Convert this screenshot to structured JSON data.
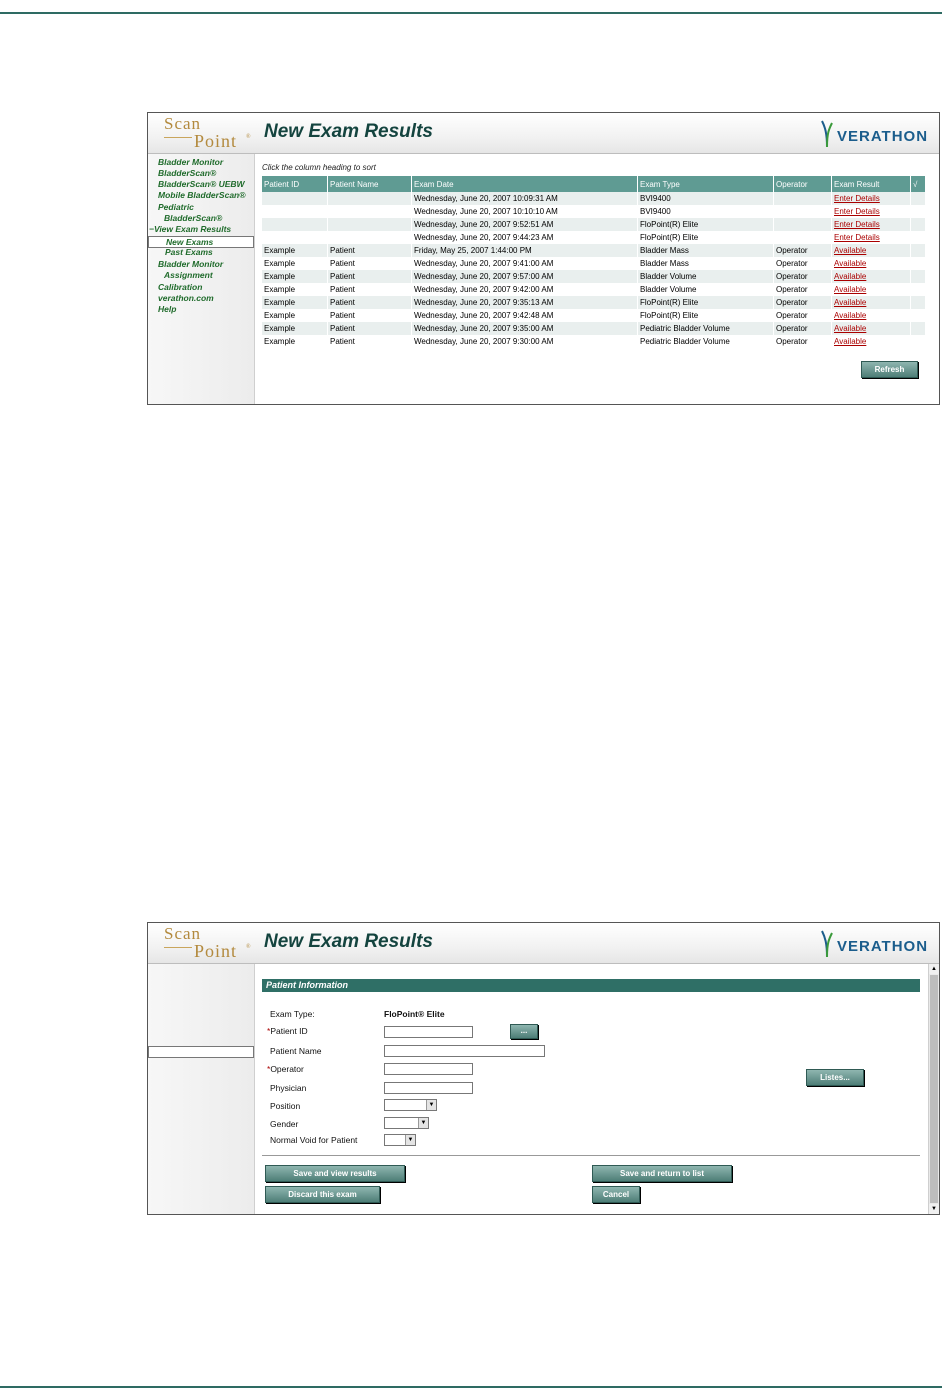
{
  "panel1": {
    "logo": {
      "line1": "Scan",
      "line2": "Point",
      "reg": "®"
    },
    "title": "New Exam Results",
    "brand": "VERATHON",
    "sidebar": [
      {
        "label": "Bladder Monitor",
        "indent": 0
      },
      {
        "label": "BladderScan®",
        "indent": 0
      },
      {
        "label": "BladderScan® UEBW",
        "indent": 0
      },
      {
        "label": "Mobile BladderScan®",
        "indent": 0
      },
      {
        "label": "Pediatric",
        "indent": 0
      },
      {
        "label": "BladderScan®",
        "indent": 1
      },
      {
        "label": "−View Exam Results",
        "indent": -1
      },
      {
        "label": "New Exams",
        "indent": 2,
        "selected": true
      },
      {
        "label": "Past Exams",
        "indent": 2
      },
      {
        "label": "Bladder Monitor",
        "indent": 0
      },
      {
        "label": "Assignment",
        "indent": 1
      },
      {
        "label": "Calibration",
        "indent": 0
      },
      {
        "label": "verathon.com",
        "indent": 0
      },
      {
        "label": "Help",
        "indent": 0
      }
    ],
    "sort_hint": "Click the column heading to sort",
    "columns": [
      "Patient ID",
      "Patient Name",
      "Exam Date",
      "Exam Type",
      "Operator",
      "Exam Result",
      "√"
    ],
    "rows": [
      [
        "",
        "",
        "Wednesday, June 20, 2007 10:09:31 AM",
        "BVI9400",
        "",
        "Enter Details"
      ],
      [
        "",
        "",
        "Wednesday, June 20, 2007 10:10:10 AM",
        "BVI9400",
        "",
        "Enter Details"
      ],
      [
        "",
        "",
        "Wednesday, June 20, 2007 9:52:51 AM",
        "FloPoint(R) Elite",
        "",
        "Enter Details"
      ],
      [
        "",
        "",
        "Wednesday, June 20, 2007 9:44:23 AM",
        "FloPoint(R) Elite",
        "",
        "Enter Details"
      ],
      [
        "Example",
        "Patient",
        "Friday, May 25, 2007 1:44:00 PM",
        "Bladder Mass",
        "Operator",
        "Available"
      ],
      [
        "Example",
        "Patient",
        "Wednesday, June 20, 2007 9:41:00 AM",
        "Bladder Mass",
        "Operator",
        "Available"
      ],
      [
        "Example",
        "Patient",
        "Wednesday, June 20, 2007 9:57:00 AM",
        "Bladder Volume",
        "Operator",
        "Available"
      ],
      [
        "Example",
        "Patient",
        "Wednesday, June 20, 2007 9:42:00 AM",
        "Bladder Volume",
        "Operator",
        "Available"
      ],
      [
        "Example",
        "Patient",
        "Wednesday, June 20, 2007 9:35:13 AM",
        "FloPoint(R) Elite",
        "Operator",
        "Available"
      ],
      [
        "Example",
        "Patient",
        "Wednesday, June 20, 2007 9:42:48 AM",
        "FloPoint(R) Elite",
        "Operator",
        "Available"
      ],
      [
        "Example",
        "Patient",
        "Wednesday, June 20, 2007 9:35:00 AM",
        "Pediatric Bladder Volume",
        "Operator",
        "Available"
      ],
      [
        "Example",
        "Patient",
        "Wednesday, June 20, 2007 9:30:00 AM",
        "Pediatric Bladder Volume",
        "Operator",
        "Available"
      ]
    ],
    "refresh_label": "Refresh"
  },
  "panel2": {
    "logo": {
      "line1": "Scan",
      "line2": "Point",
      "reg": "®"
    },
    "title": "New Exam Results",
    "brand": "VERATHON",
    "section_title": "Patient Information",
    "exam_type_label": "Exam Type:",
    "exam_type_value": "FloPoint® Elite",
    "required_mark": "*",
    "patient_id_label": "Patient ID",
    "lookup_label": "...",
    "patient_name_label": "Patient Name",
    "operator_label": "Operator",
    "physician_label": "Physician",
    "position_label": "Position",
    "gender_label": "Gender",
    "normal_void_label": "Normal Void for Patient",
    "listes_label": "Listes...",
    "save_view_label": "Save and view results",
    "save_return_label": "Save and return to list",
    "discard_label": "Discard this exam",
    "cancel_label": "Cancel"
  }
}
